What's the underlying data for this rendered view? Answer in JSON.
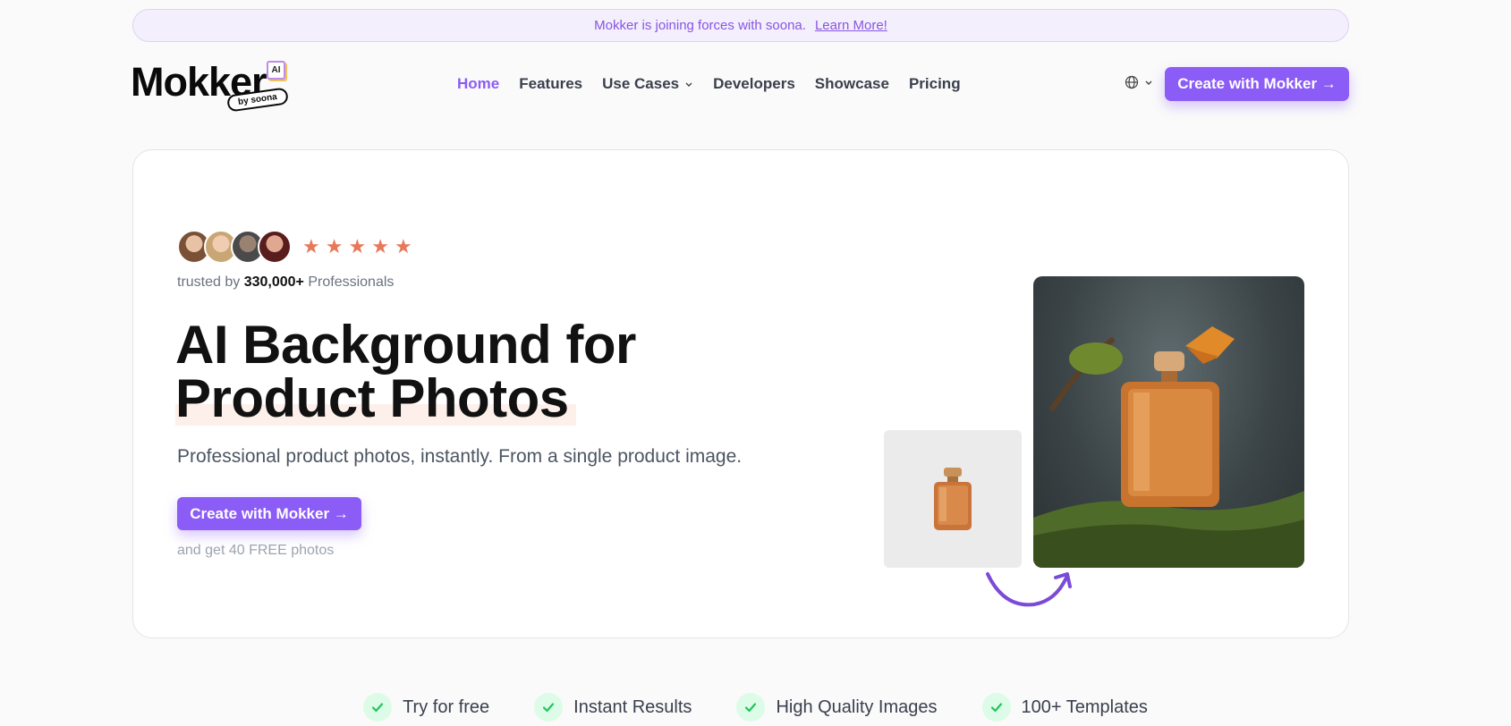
{
  "banner": {
    "text": "Mokker is joining forces with soona.",
    "link": "Learn More!"
  },
  "logo": {
    "word": "Mokker",
    "badge": "AI",
    "tag": "by soona"
  },
  "nav": {
    "home": "Home",
    "features": "Features",
    "use_cases": "Use Cases",
    "developers": "Developers",
    "showcase": "Showcase",
    "pricing": "Pricing"
  },
  "header": {
    "cta": "Create with Mokker →"
  },
  "hero": {
    "rating_stars": 5,
    "trusted_prefix": "trusted by",
    "trusted_count": "330,000+",
    "trusted_suffix": "Professionals",
    "headline_line1": "AI Background for",
    "headline_line2": "Product Photos",
    "subtext": "Professional product photos, instantly. From a single product image.",
    "cta": "Create with Mokker →",
    "note": "and get 40 FREE photos"
  },
  "features": [
    {
      "label": "Try for free"
    },
    {
      "label": "Instant Results"
    },
    {
      "label": "High Quality Images"
    },
    {
      "label": "100+ Templates"
    }
  ],
  "colors": {
    "accent": "#8b5cf6",
    "star": "#e8785a",
    "check": "#22c55e"
  }
}
